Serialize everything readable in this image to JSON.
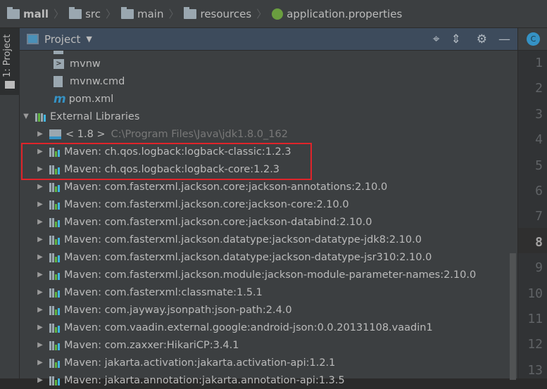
{
  "breadcrumb": [
    "mall",
    "src",
    "main",
    "resources",
    "application.properties"
  ],
  "sidebar_tab": "1: Project",
  "panel": {
    "title": "Project",
    "tools": [
      "locate-icon",
      "collapse-icon",
      "gear-icon",
      "minimize-icon"
    ]
  },
  "tree": {
    "files": [
      "mvnw",
      "mvnw.cmd",
      "pom.xml"
    ],
    "external_libraries": "External Libraries",
    "jdk": {
      "label": "< 1.8 >",
      "path": "C:\\Program Files\\Java\\jdk1.8.0_162"
    },
    "libs": [
      "Maven: ch.qos.logback:logback-classic:1.2.3",
      "Maven: ch.qos.logback:logback-core:1.2.3",
      "Maven: com.fasterxml.jackson.core:jackson-annotations:2.10.0",
      "Maven: com.fasterxml.jackson.core:jackson-core:2.10.0",
      "Maven: com.fasterxml.jackson.core:jackson-databind:2.10.0",
      "Maven: com.fasterxml.jackson.datatype:jackson-datatype-jdk8:2.10.0",
      "Maven: com.fasterxml.jackson.datatype:jackson-datatype-jsr310:2.10.0",
      "Maven: com.fasterxml.jackson.module:jackson-module-parameter-names:2.10.0",
      "Maven: com.fasterxml:classmate:1.5.1",
      "Maven: com.jayway.jsonpath:json-path:2.4.0",
      "Maven: com.vaadin.external.google:android-json:0.0.20131108.vaadin1",
      "Maven: com.zaxxer:HikariCP:3.4.1",
      "Maven: jakarta.activation:jakarta.activation-api:1.2.1",
      "Maven: jakarta.annotation:jakarta.annotation-api:1.3.5"
    ]
  },
  "editor": {
    "tab_icon": "C",
    "line_numbers": [
      "1",
      "2",
      "3",
      "4",
      "5",
      "6",
      "7",
      "8",
      "9",
      "10",
      "11",
      "12",
      "13"
    ],
    "current_line": "8"
  }
}
